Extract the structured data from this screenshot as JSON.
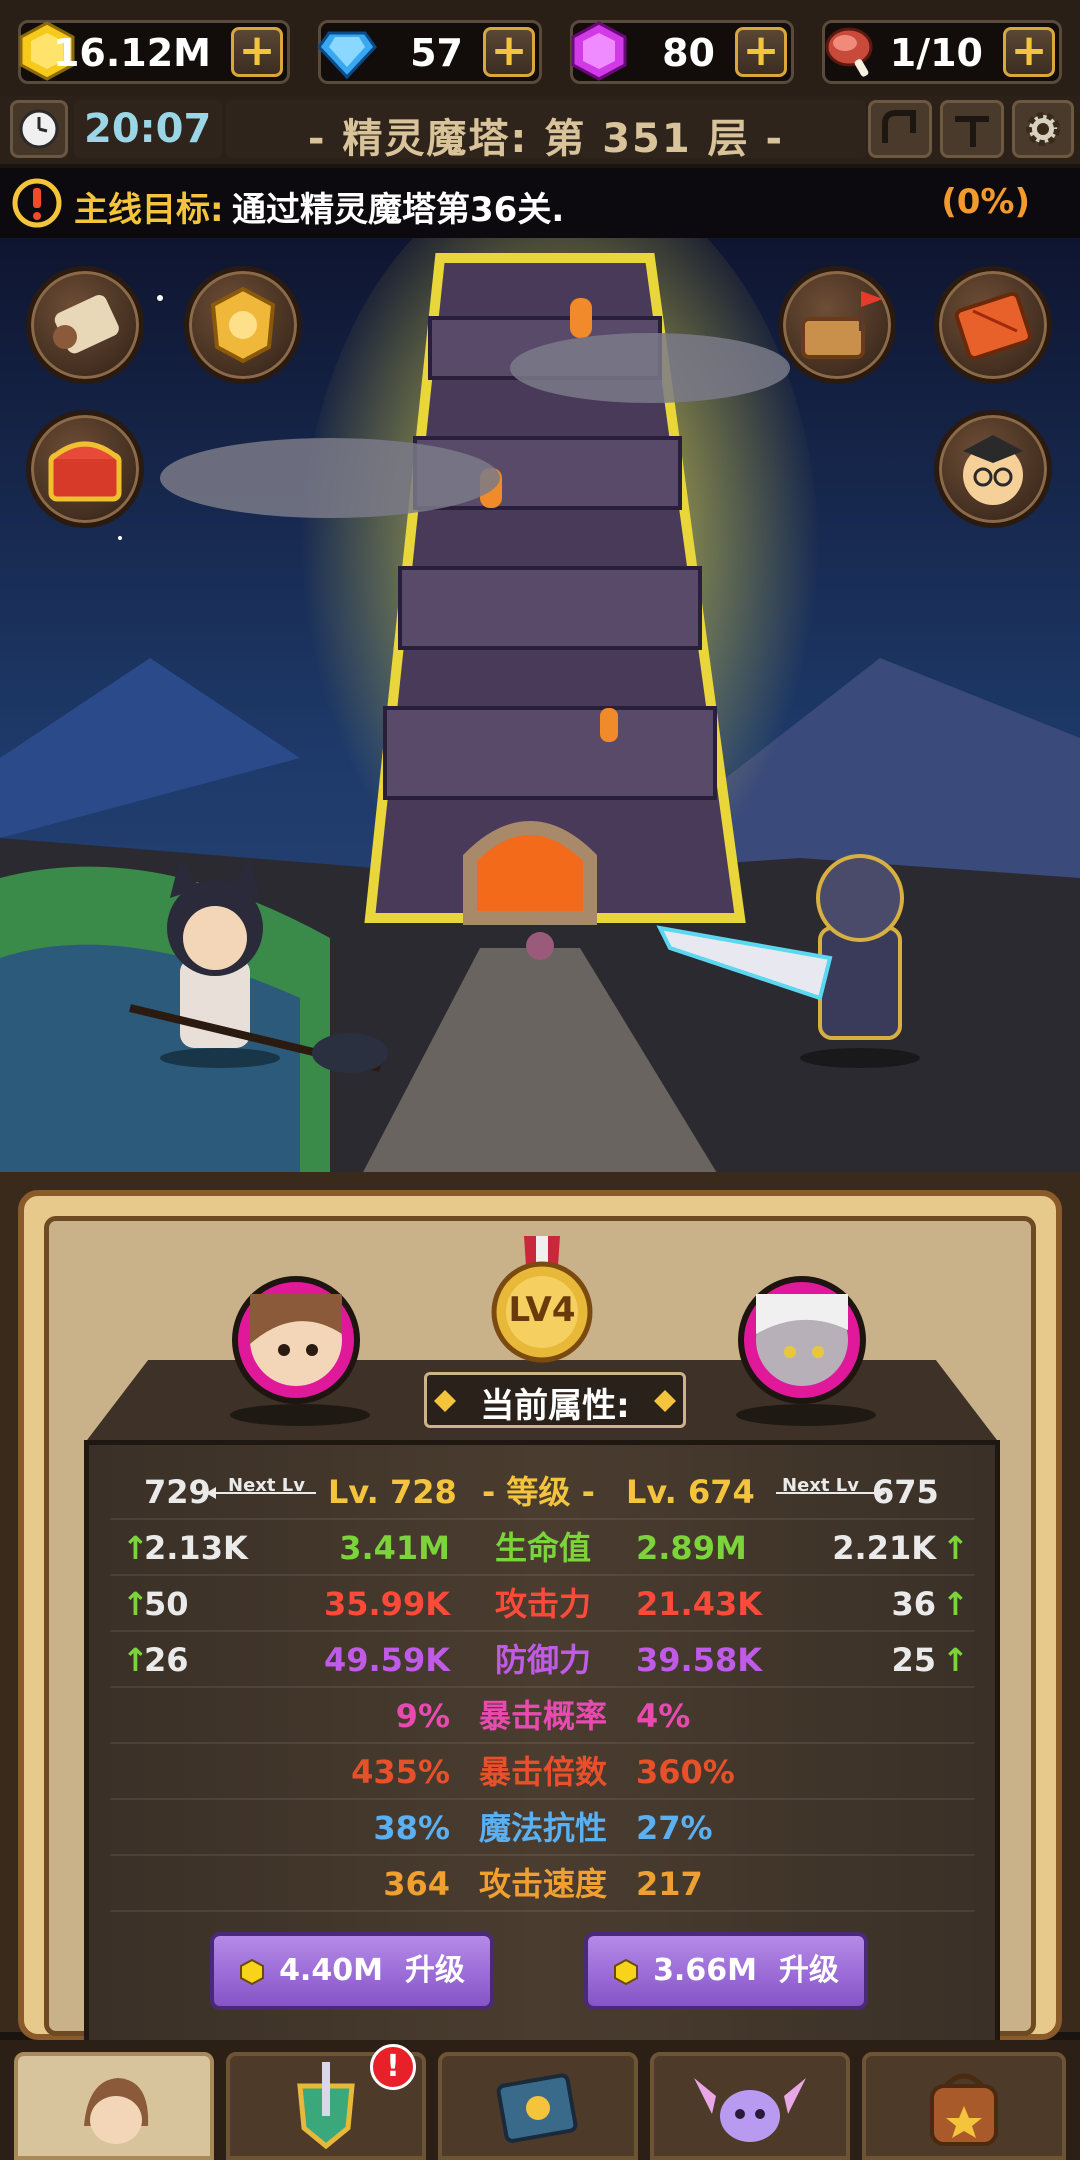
{
  "resources": {
    "gold": {
      "value": "16.12M",
      "icon": "gold-gem-icon"
    },
    "diamond": {
      "value": "57",
      "icon": "blue-diamond-icon"
    },
    "pink_gem": {
      "value": "80",
      "icon": "pink-gem-icon"
    },
    "stamina": {
      "value": "1/10",
      "icon": "meat-icon"
    },
    "plus_label": "+"
  },
  "status_bar": {
    "time": "20:07",
    "floor_title": "- 精灵魔塔: 第 351 层 -"
  },
  "quest": {
    "label": "主线目标:",
    "text": "通过精灵魔塔第36关.",
    "progress": "(0%)"
  },
  "panel": {
    "rank_badge": "LV4",
    "title": "当前属性:",
    "level_row": {
      "left_next": "729",
      "next_lv_label": "Next Lv",
      "left_lv": "Lv. 728",
      "center": "- 等级 -",
      "right_lv": "Lv. 674",
      "right_next": "675"
    },
    "stats": [
      {
        "left_inc": "2.13K",
        "left": "3.41M",
        "name": "生命值",
        "right": "2.89M",
        "right_inc": "2.21K",
        "color": "#7ad43a"
      },
      {
        "left_inc": "50",
        "left": "35.99K",
        "name": "攻击力",
        "right": "21.43K",
        "right_inc": "36",
        "color": "#ff4a3a"
      },
      {
        "left_inc": "26",
        "left": "49.59K",
        "name": "防御力",
        "right": "39.58K",
        "right_inc": "25",
        "color": "#c05ae8"
      },
      {
        "left_inc": "",
        "left": "9%",
        "name": "暴击概率",
        "right": "4%",
        "right_inc": "",
        "color": "#e84ab0"
      },
      {
        "left_inc": "",
        "left": "435%",
        "name": "暴击倍数",
        "right": "360%",
        "right_inc": "",
        "color": "#e8502a"
      },
      {
        "left_inc": "",
        "left": "38%",
        "name": "魔法抗性",
        "right": "27%",
        "right_inc": "",
        "color": "#5ab0f0"
      },
      {
        "left_inc": "",
        "left": "364",
        "name": "攻击速度",
        "right": "217",
        "right_inc": "",
        "color": "#f0a030"
      }
    ],
    "upgrade_left": {
      "cost": "4.40M",
      "label": "升级"
    },
    "upgrade_right": {
      "cost": "3.66M",
      "label": "升级"
    }
  },
  "nav": {
    "tabs": [
      {
        "icon": "hero-portrait-icon",
        "active": true
      },
      {
        "icon": "sword-shield-icon",
        "badge": "!"
      },
      {
        "icon": "spellbook-icon"
      },
      {
        "icon": "winged-pet-icon"
      },
      {
        "icon": "backpack-icon"
      }
    ]
  }
}
